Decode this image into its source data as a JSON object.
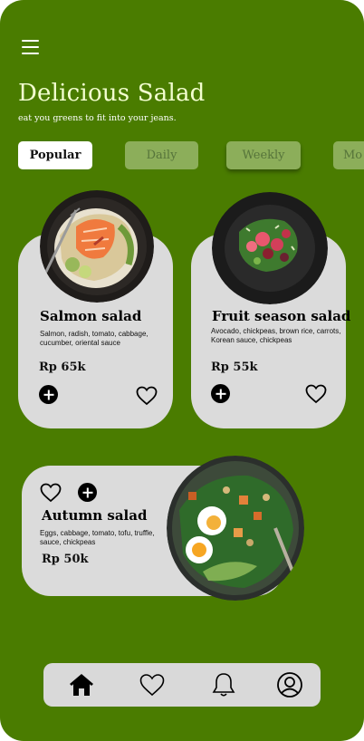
{
  "header": {
    "title": "Delicious Salad",
    "subtitle": "eat you greens to fit into your jeans."
  },
  "tabs": [
    {
      "label": "Popular",
      "active": true
    },
    {
      "label": "Daily",
      "active": false
    },
    {
      "label": "Weekly",
      "active": false
    },
    {
      "label": "Mo",
      "active": false
    }
  ],
  "items": [
    {
      "name": "Salmon salad",
      "ingredients": "Salmon, radish, tomato, cabbage, cucumber, oriental sauce",
      "price": "Rp 65k"
    },
    {
      "name": "Fruit season salad",
      "ingredients": "Avocado, chickpeas, brown rice, carrots, Korean sauce, chickpeas",
      "price": "Rp 55k"
    },
    {
      "name": "Autumn salad",
      "ingredients": "Eggs, cabbage, tomato, tofu, truffle, sauce, chickpeas",
      "price": "Rp 50k"
    }
  ],
  "nav": [
    "home-icon",
    "heart-icon",
    "bell-icon",
    "profile-icon"
  ],
  "colors": {
    "background": "#4a7c00",
    "card": "#dbdbdb",
    "title": "#f3ffd0",
    "inactive_tab": "#8cae5a"
  }
}
